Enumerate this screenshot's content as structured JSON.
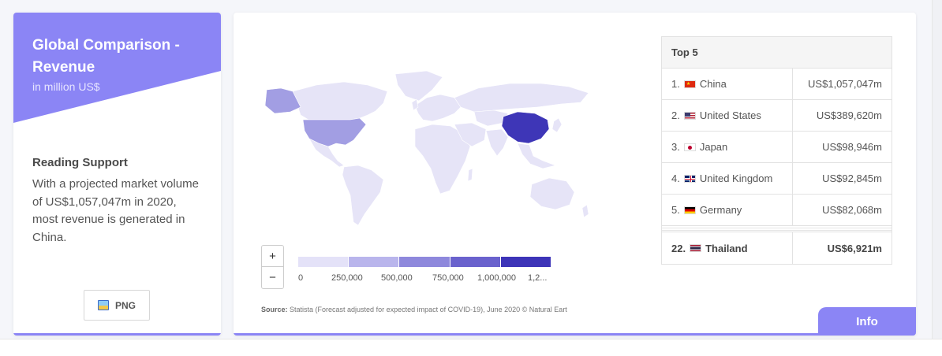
{
  "left_card": {
    "title": "Global Comparison - Revenue",
    "subtitle": "in million US$",
    "support_title": "Reading Support",
    "support_text": "With a projected market volume of US$1,057,047m in 2020, most revenue is generated in China.",
    "png_button": "PNG",
    "icon": "image-icon"
  },
  "map": {
    "zoom_in": "+",
    "zoom_out": "−",
    "legend_colors": [
      "#e4e2f8",
      "#b9b5ec",
      "#8e88dc",
      "#6a62cd",
      "#3d34b8"
    ],
    "legend_labels": [
      "0",
      "250,000",
      "500,000",
      "750,000",
      "1,000,000",
      "1,2..."
    ],
    "highlight_colors": {
      "china": "#3e36b7",
      "usa": "#a29ee3",
      "default": "#e6e4f7"
    },
    "source_label": "Source:",
    "source_text": " Statista (Forecast adjusted for expected impact of COVID-19), June 2020 © Natural Eart"
  },
  "top5": {
    "header": "Top 5",
    "rows": [
      {
        "rank": "1.",
        "flag": "china-flag",
        "country": "China",
        "value": "US$1,057,047m"
      },
      {
        "rank": "2.",
        "flag": "usa-flag",
        "country": "United States",
        "value": "US$389,620m"
      },
      {
        "rank": "3.",
        "flag": "japan-flag",
        "country": "Japan",
        "value": "US$98,946m"
      },
      {
        "rank": "4.",
        "flag": "uk-flag",
        "country": "United Kingdom",
        "value": "US$92,845m"
      },
      {
        "rank": "5.",
        "flag": "germany-flag",
        "country": "Germany",
        "value": "US$82,068m"
      }
    ],
    "highlight": {
      "rank": "22.",
      "flag": "thailand-flag",
      "country": "Thailand",
      "value": "US$6,921m"
    }
  },
  "info_button": "Info",
  "colors": {
    "accent": "#8b85f5"
  }
}
